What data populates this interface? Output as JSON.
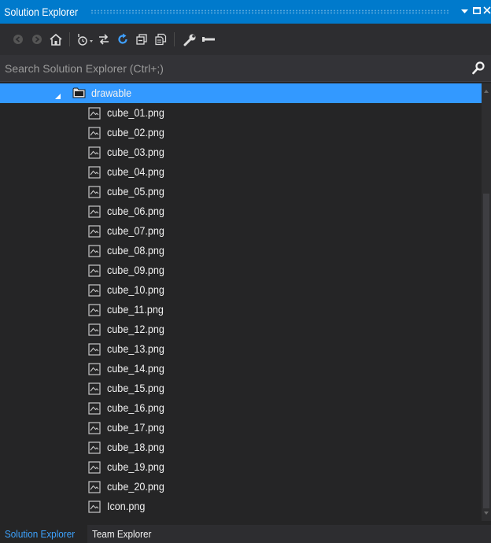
{
  "window": {
    "title": "Solution Explorer",
    "pin_icon": "dropdown-arrow-icon",
    "maximize_icon": "maximize-icon",
    "close_icon": "close-icon"
  },
  "toolbar": {
    "icons": [
      "back-arrow-icon",
      "forward-arrow-icon",
      "home-icon",
      "pending-changes-icon",
      "sync-icon",
      "refresh-icon",
      "collapse-all-icon",
      "show-all-files-icon",
      "properties-wrench-icon",
      "preview-icon"
    ]
  },
  "search": {
    "placeholder": "Search Solution Explorer (Ctrl+;)"
  },
  "tree": {
    "folder": {
      "label": "drawable",
      "expanded": true
    },
    "files": [
      "cube_01.png",
      "cube_02.png",
      "cube_03.png",
      "cube_04.png",
      "cube_05.png",
      "cube_06.png",
      "cube_07.png",
      "cube_08.png",
      "cube_09.png",
      "cube_10.png",
      "cube_11.png",
      "cube_12.png",
      "cube_13.png",
      "cube_14.png",
      "cube_15.png",
      "cube_16.png",
      "cube_17.png",
      "cube_18.png",
      "cube_19.png",
      "cube_20.png",
      "Icon.png"
    ]
  },
  "tabs": {
    "items": [
      {
        "label": "Solution Explorer",
        "active": true
      },
      {
        "label": "Team Explorer",
        "active": false
      }
    ]
  },
  "colors": {
    "accent": "#007acc",
    "selection": "#3399ff",
    "background": "#252526",
    "text": "#f1f1f1"
  }
}
